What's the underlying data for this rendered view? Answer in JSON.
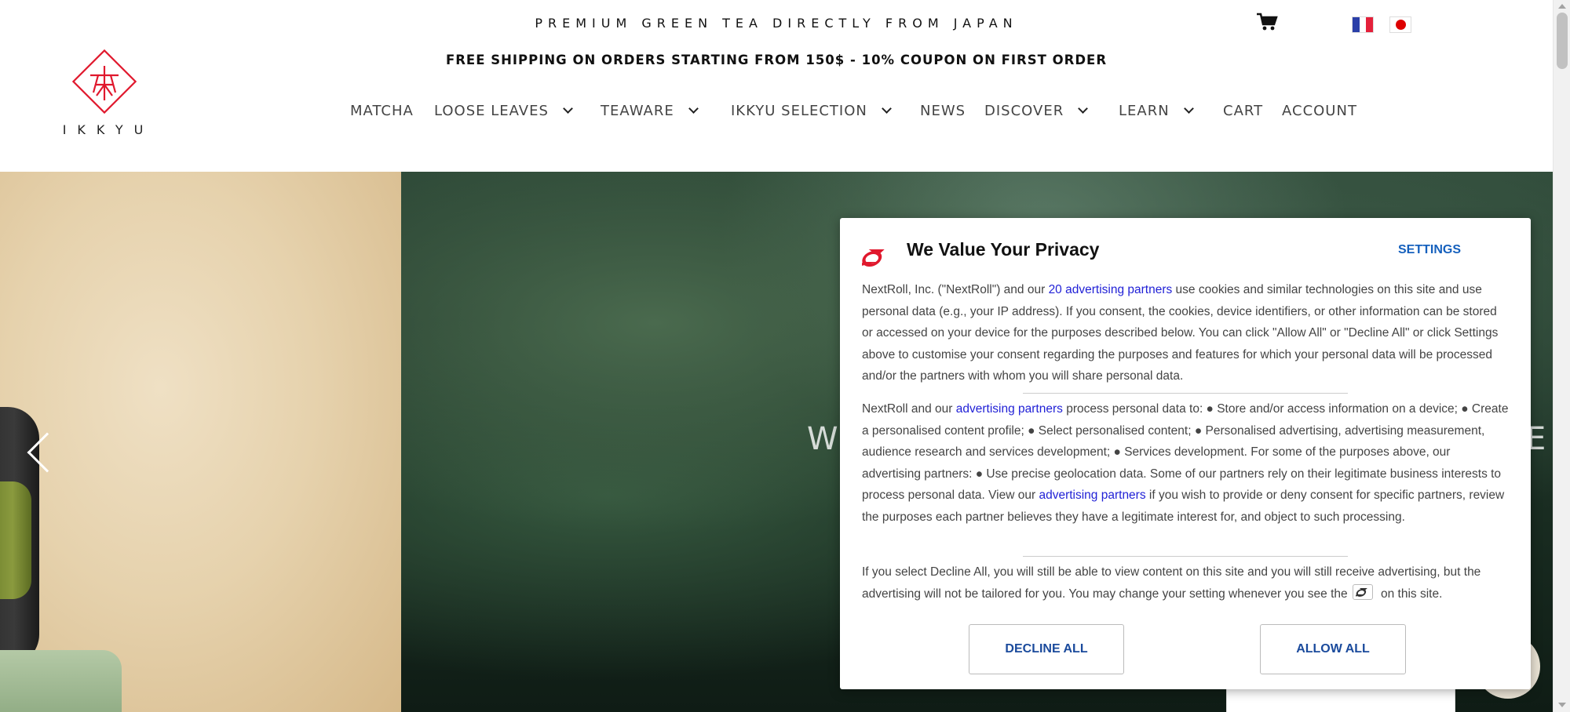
{
  "header": {
    "tagline": "PREMIUM GREEN TEA DIRECTLY FROM JAPAN",
    "shipping": "FREE SHIPPING ON ORDERS STARTING FROM 150$ - 10% COUPON ON FIRST ORDER",
    "logo_text": "IKKYU",
    "cart_icon": "cart-icon",
    "languages": [
      "fr-flag",
      "jp-flag"
    ]
  },
  "nav": {
    "items": [
      {
        "label": "MATCHA",
        "has_dropdown": false
      },
      {
        "label": "LOOSE LEAVES",
        "has_dropdown": true
      },
      {
        "label": "TEAWARE",
        "has_dropdown": true
      },
      {
        "label": "IKKYU SELECTION",
        "has_dropdown": true
      },
      {
        "label": "NEWS",
        "has_dropdown": false
      },
      {
        "label": "DISCOVER",
        "has_dropdown": true
      },
      {
        "label": "LEARN",
        "has_dropdown": true
      },
      {
        "label": "CART",
        "has_dropdown": false
      },
      {
        "label": "ACCOUNT",
        "has_dropdown": false
      }
    ]
  },
  "hero": {
    "text_left": "W",
    "text_right": "E",
    "prev_icon": "chevron-left-icon"
  },
  "consent": {
    "title": "We Value Your Privacy",
    "settings_label": "SETTINGS",
    "p1": {
      "pre": "NextRoll, Inc. (\"NextRoll\") and our ",
      "link": "20 advertising partners",
      "post": " use cookies and similar technologies on this site and use personal data (e.g., your IP address). If you consent, the cookies, device identifiers, or other information can be stored or accessed on your device for the purposes described below. You can click \"Allow All\" or \"Decline All\" or click Settings above to customise your consent regarding the purposes and features for which your personal data will be processed and/or the partners with whom you will share personal data."
    },
    "p2": {
      "pre": "NextRoll and our ",
      "link1": "advertising partners",
      "mid": " process personal data to: ● Store and/or access information on a device; ● Create a personalised content profile; ● Select personalised content; ● Personalised advertising, advertising measurement, audience research and services development; ● Services development. For some of the purposes above, our advertising partners: ● Use precise geolocation data. Some of our partners rely on their legitimate business interests to process personal data. View our ",
      "link2": "advertising partners",
      "post": " if you wish to provide or deny consent for specific partners, review the purposes each partner believes they have a legitimate interest for, and object to such processing."
    },
    "p3": {
      "pre": "If you select Decline All, you will still be able to view content on this site and you will still receive advertising, but the advertising will not be tailored for you. You may change your setting whenever you see the",
      "post": "on this site."
    },
    "decline_label": "DECLINE ALL",
    "allow_label": "ALLOW ALL",
    "brand_color": "#e0182d",
    "link_color": "#1f1fd6"
  },
  "colors": {
    "logo_red": "#e0182d",
    "button_text": "#1a4a9c",
    "settings_text": "#1560bd"
  }
}
